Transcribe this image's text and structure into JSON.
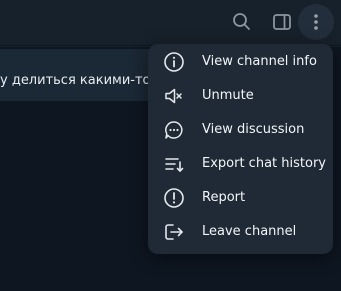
{
  "header": {
    "icons": [
      "search-icon",
      "sidebar-toggle-icon",
      "more-vertical-icon"
    ]
  },
  "pinned": {
    "text": "у делиться какими-то новостями и мыслям...",
    "close_label": "×"
  },
  "menu": {
    "items": [
      {
        "label": "View channel info",
        "icon": "info-icon"
      },
      {
        "label": "Unmute",
        "icon": "speaker-muted-icon"
      },
      {
        "label": "View discussion",
        "icon": "chat-bubble-icon"
      },
      {
        "label": "Export chat history",
        "icon": "export-history-icon"
      },
      {
        "label": "Report",
        "icon": "report-icon"
      },
      {
        "label": "Leave channel",
        "icon": "leave-icon"
      }
    ]
  },
  "colors": {
    "background": "#17212b",
    "menu_bg": "#1f2a36",
    "chat_bg": "#0e1621",
    "text": "#f3f6f8",
    "icon": "#e4e8ec"
  }
}
